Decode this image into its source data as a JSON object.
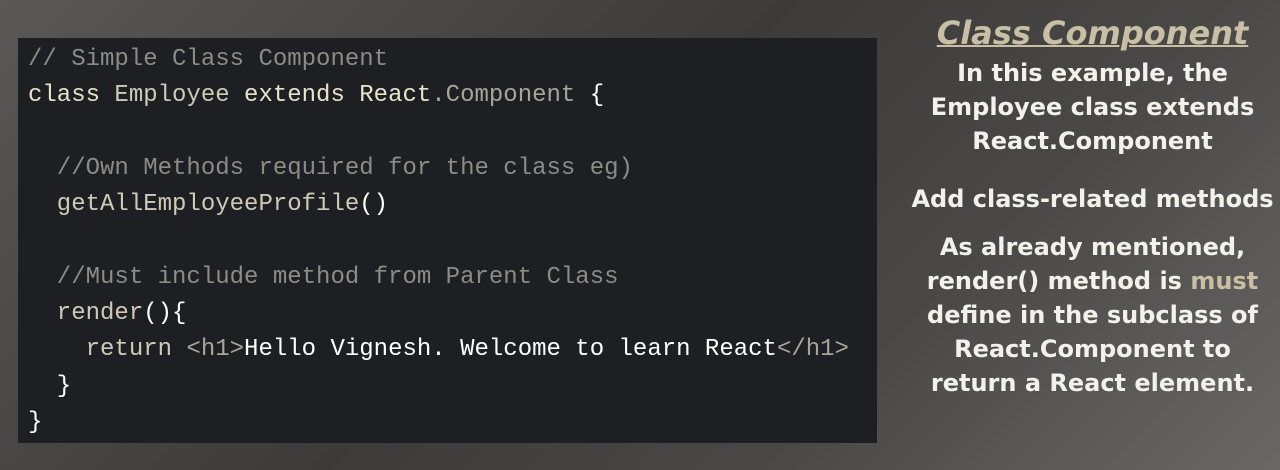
{
  "code_lines": [
    [
      {
        "t": "// Simple Class Component",
        "c": "comment"
      }
    ],
    [
      {
        "t": "class ",
        "c": "kw"
      },
      {
        "t": "Employee ",
        "c": "plain"
      },
      {
        "t": "extends ",
        "c": "kw"
      },
      {
        "t": "React",
        "c": "kw"
      },
      {
        "t": ".Component ",
        "c": "dim"
      },
      {
        "t": "{",
        "c": "bright"
      }
    ],
    [],
    [
      {
        "t": "  //Own Methods required for the class eg)",
        "c": "comment"
      }
    ],
    [
      {
        "t": "  getAllEmployeeProfile",
        "c": "plain"
      },
      {
        "t": "()",
        "c": "bright"
      }
    ],
    [],
    [
      {
        "t": "  //Must include method from Parent Class",
        "c": "comment"
      }
    ],
    [
      {
        "t": "  render",
        "c": "plain"
      },
      {
        "t": "(){",
        "c": "bright"
      }
    ],
    [
      {
        "t": "    return ",
        "c": "plain"
      },
      {
        "t": "<h1>",
        "c": "dim"
      },
      {
        "t": "Hello Vignesh. Welcome to learn React",
        "c": "bright"
      },
      {
        "t": "</h1>",
        "c": "dim"
      }
    ],
    [
      {
        "t": "  }",
        "c": "bright"
      }
    ],
    [
      {
        "t": "}",
        "c": "bright"
      }
    ]
  ],
  "side": {
    "title": "Class Component",
    "para1": "In this example, the Employee class extends React.Component",
    "para2": "Add class-related methods",
    "para3_before": "As already mentioned, render() method is ",
    "para3_accent": "must",
    "para3_after": " define in the subclass of React.Component to return a React element."
  },
  "colors": {
    "accent": "#c8bfa4",
    "code_bg": "#1d1f23",
    "comment": "#8d8b84"
  }
}
